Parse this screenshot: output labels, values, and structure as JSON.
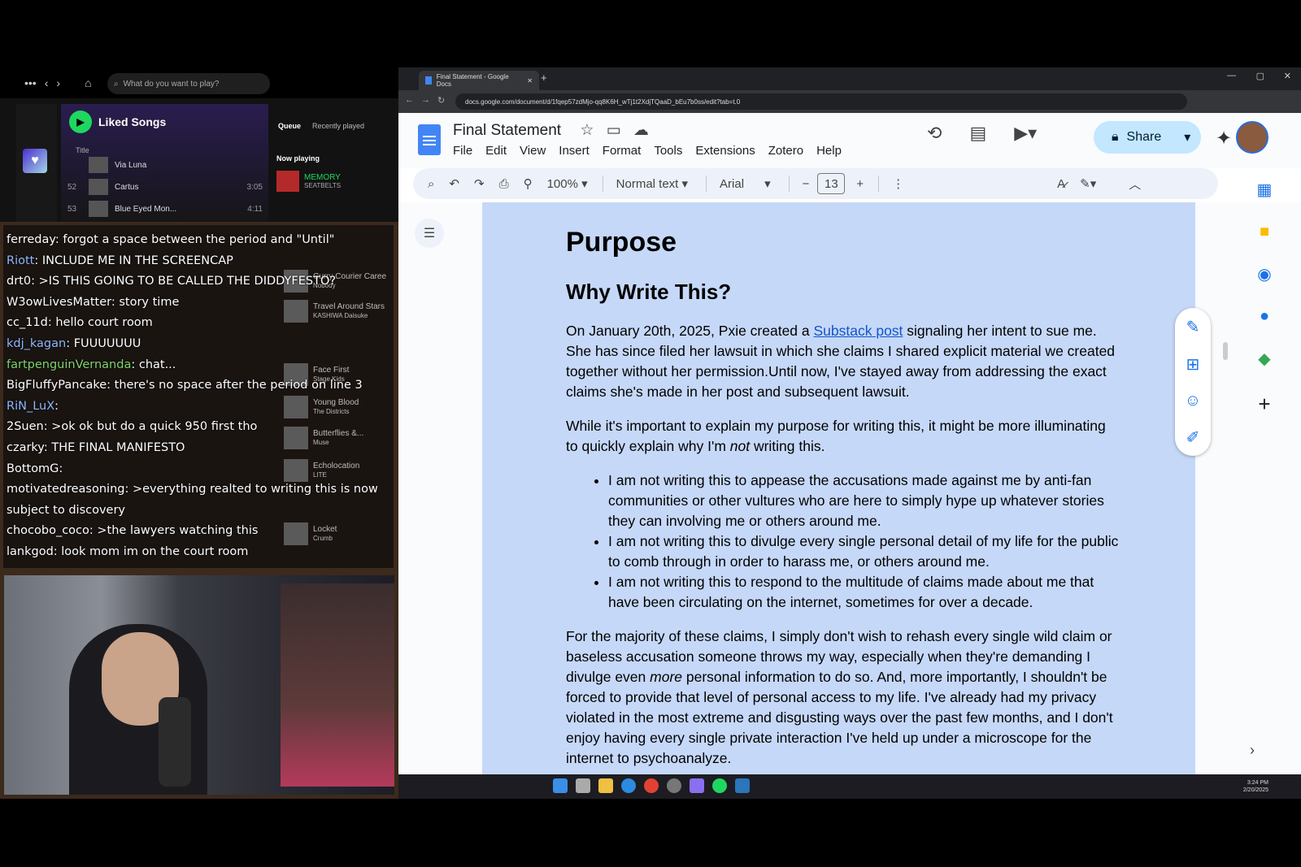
{
  "spotify": {
    "search_placeholder": "What do you want to play?",
    "playlist_title": "Liked Songs",
    "col_title": "Title",
    "tracks": [
      {
        "num": "",
        "name": "Via Luna",
        "duration": ""
      },
      {
        "num": "52",
        "name": "Cartus",
        "duration": "3:05"
      },
      {
        "num": "53",
        "name": "Blue Eyed Mon...",
        "duration": "4:11"
      }
    ],
    "queue_tab": "Queue",
    "recent_tab": "Recently played",
    "now_playing_label": "Now playing",
    "now_playing_title": "MEMORY",
    "now_playing_artist": "SEATBELTS"
  },
  "queue_ghost": [
    {
      "title": "Curry Courier Caree",
      "artist": "Nobody"
    },
    {
      "title": "Travel Around Stars",
      "artist": "KASHIWA Daisuke"
    },
    {
      "title": "Face First",
      "artist": "Stage Kids"
    },
    {
      "title": "Young Blood",
      "artist": "The Districts"
    },
    {
      "title": "Butterflies &...",
      "artist": "Muse"
    },
    {
      "title": "Echolocation",
      "artist": "LITE"
    },
    {
      "title": "Locket",
      "artist": "Crumb"
    }
  ],
  "chat": [
    {
      "user": "ferreday",
      "color": "#ffffff",
      "text": "forgot a space between the period and \"Until\""
    },
    {
      "user": "Riott",
      "color": "#8fb8ff",
      "text": "INCLUDE ME IN THE SCREENCAP"
    },
    {
      "user": "drt0",
      "color": "#ffffff",
      "text": ">IS THIS GOING TO BE CALLED THE DIDDYFESTO?"
    },
    {
      "user": "W3owLivesMatter",
      "color": "#ffffff",
      "text": "story time"
    },
    {
      "user": "cc_11d",
      "color": "#ffffff",
      "text": "hello court room"
    },
    {
      "user": "kdj_kagan",
      "color": "#8fb8ff",
      "text": "FUUUUUUU"
    },
    {
      "user": "fartpenguinVernanda",
      "color": "#7ed36b",
      "text": "chat..."
    },
    {
      "user": "BigFluffyPancake",
      "color": "#ffffff",
      "text": "there's no space after the period on line 3"
    },
    {
      "user": "RiN_LuX",
      "color": "#8fb8ff",
      "text": ""
    },
    {
      "user": "2Suen",
      "color": "#ffffff",
      "text": ">ok ok but do a quick 950 first tho"
    },
    {
      "user": "czarky",
      "color": "#ffffff",
      "text": "THE FINAL MANIFESTO"
    },
    {
      "user": "BottomG",
      "color": "#ffffff",
      "text": ""
    },
    {
      "user": "motivatedreasoning",
      "color": "#ffffff",
      "text": ">everything realted to writing this is now"
    },
    {
      "user": "",
      "color": "#ffffff",
      "text": "subject to discovery"
    },
    {
      "user": "chocobo_coco",
      "color": "#ffffff",
      "text": ">the lawyers watching this"
    },
    {
      "user": "lankgod",
      "color": "#ffffff",
      "text": "look mom im on the court room"
    }
  ],
  "browser": {
    "tab_title": "Final Statement - Google Docs",
    "url": "docs.google.com/document/d/1fqep57zdMjo-qq8K6H_wTj1t2XdjTQaaD_bEu7b0ss/edit?tab=t.0"
  },
  "docs": {
    "title": "Final Statement",
    "menus": [
      "File",
      "Edit",
      "View",
      "Insert",
      "Format",
      "Tools",
      "Extensions",
      "Zotero",
      "Help"
    ],
    "share_label": "Share",
    "zoom": "100%",
    "style": "Normal text",
    "font": "Arial",
    "font_size": "13"
  },
  "document": {
    "h1": "Purpose",
    "h2": "Why Write This?",
    "p1_a": "On January 20th, 2025, Pxie created a ",
    "p1_link": "Substack post",
    "p1_b": " signaling her intent to sue me. She has since filed her lawsuit in which she claims I shared explicit material we created together without her permission.Until now, I've stayed away from addressing the exact claims she's made in her post and subsequent lawsuit.",
    "p2_a": "While it's important to explain my purpose for writing this, it might be more illuminating to quickly explain why I'm ",
    "p2_em": "not",
    "p2_b": " writing this.",
    "bullets": [
      "I am not writing this to appease the accusations made against me by anti-fan communities or other vultures who are here to simply hype up whatever stories they can involving me or others around me.",
      "I am not writing this to divulge every single personal detail of my life for the public to comb through in order to harass me, or others around me.",
      "I am not writing this to respond to the multitude of claims made about me that have been circulating on the internet, sometimes for over a decade."
    ],
    "p3_a": "For the majority of these claims, I simply don't wish to rehash every single wild claim or baseless accusation someone throws my way, especially when they're demanding I divulge even ",
    "p3_em": "more",
    "p3_b": " personal information to do so. And, more importantly, I shouldn't be forced to provide that level of personal access to my life. I've already had my privacy violated in the most extreme and disgusting ways over the past few months, and I don't enjoy having every single private interaction I've held up under a microscope for the internet to psychoanalyze."
  },
  "taskbar": {
    "time": "3:24 PM",
    "date": "2/20/2025"
  }
}
